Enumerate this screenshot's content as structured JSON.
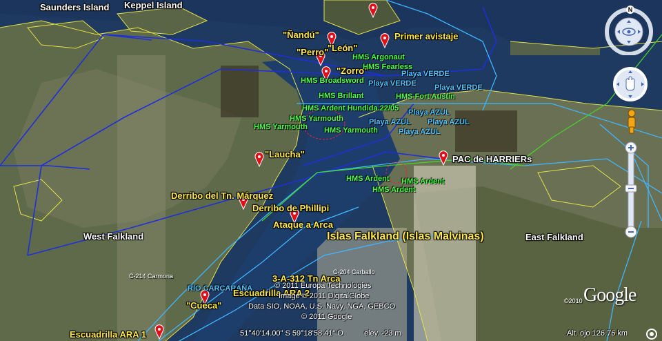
{
  "place_labels": {
    "saunders": "Saunders Island",
    "keppel": "Keppel Island",
    "west_falkland": "West Falkland",
    "east_falkland": "East Falkland",
    "islas": "Islas Falkland (Islas Malvinas)",
    "rio": "RIO CARCARAÑA"
  },
  "markers": {
    "nandu": "\"Ñandú\"",
    "perro": "\"Perro\"",
    "leon": "\"León\"",
    "zorro": "\"Zorro\"",
    "primer": "Primer avistaje",
    "laucha": "\"Laucha\"",
    "pac": "PAC de HARRIERs",
    "derribo_marquez": "Derribo del Tn. Márquez",
    "derribo_phillipi": "Derribo de Phillipi",
    "ataque_arca": "Ataque a Arca",
    "arca_312": "3-A-312 Tn Arca",
    "escuadrilla_ara": "Escuadrilla ARA 1",
    "cueca": "\"Cueca\"",
    "escuadrilla2": "Escuadrilla ARA 2",
    "c214": "C-214 Carmona",
    "c204": "C-204 Carballo"
  },
  "ships": {
    "argonaut": "HMS Argonaut",
    "fearless": "HMS Fearless",
    "broadsword": "HMS Broadsword",
    "brillant": "HMS Brillant",
    "fort_austin": "HMS Fort Austin",
    "ardent_hundida": "HMS Ardent Hundida 22/05",
    "yarmouth1": "HMS Yarmouth",
    "yarmouth2": "HMS Yarmouth",
    "yarmouth3": "HMS Yarmouth",
    "ardent1": "HMS Ardent",
    "ardent2": "HMS Ardent",
    "ardent3": "HMS Ardent"
  },
  "beaches": {
    "verde1": "Playa VERDE",
    "verde2": "Playa VERDE",
    "verde3": "Playa VERDE",
    "azul1": "Playa AZUL",
    "azul2": "Playa AZUL",
    "azul3": "Playa AZUL",
    "azul4": "Playa AZUL"
  },
  "credits": {
    "line1": "© 2011 Europa Technologies",
    "line2": "Image © 2011 DigitalGlobe",
    "line3": "Data SIO, NOAA, U.S. Navy, NGA, GEBCO",
    "line4": "© 2011 Google",
    "year": "©2010"
  },
  "logo": "Google",
  "status": {
    "coords": "51°40'14.00\" S    59°18'58.41\" O",
    "elev": "elev.  -23 m",
    "alt": "Alt. ojo   126.76 km"
  },
  "controls": {
    "north": "N"
  },
  "colors": {
    "label_yellow": "#ffe94a",
    "ship_green": "#4dff4d",
    "beach_blue": "#4fc3ff",
    "track_blue": "#1f2fd8",
    "track_cyan": "#3fb6ff",
    "pin_red": "#e0101a"
  }
}
